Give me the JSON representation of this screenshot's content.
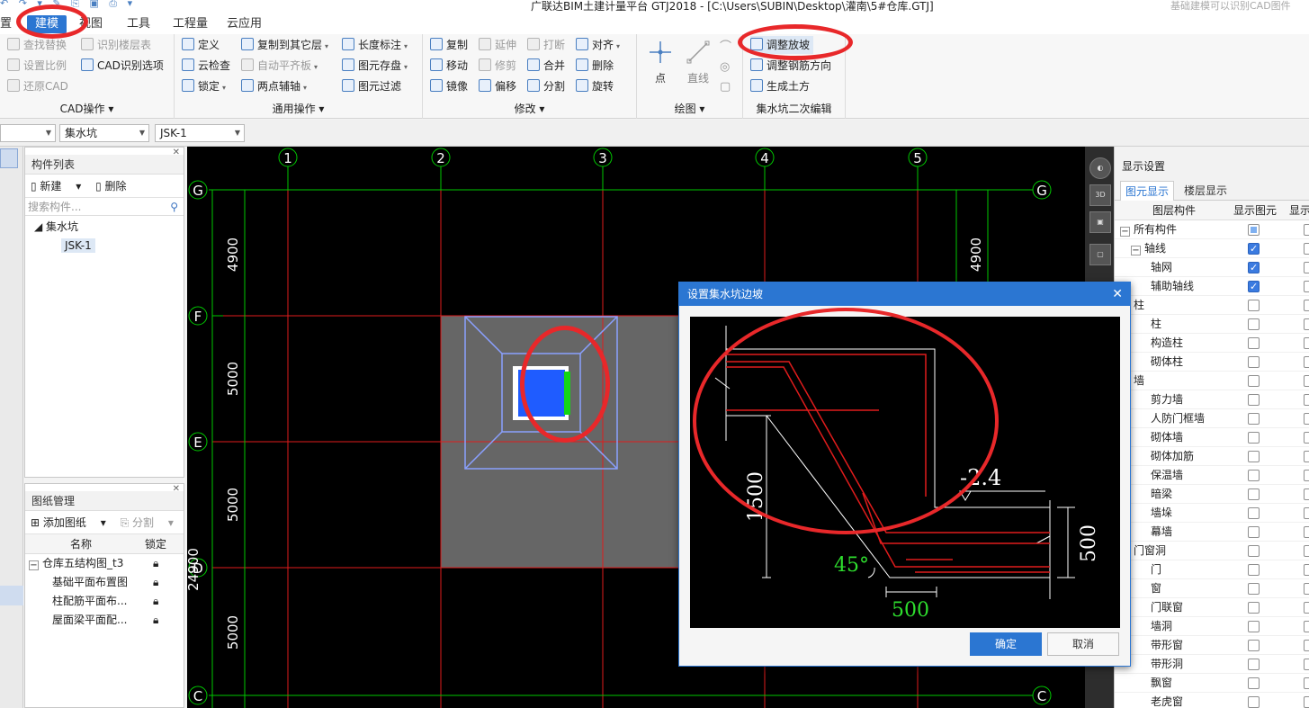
{
  "window": {
    "title": "广联达BIM土建计量平台 GTJ2018 - [C:\\Users\\SUBIN\\Desktop\\灌南\\5#仓库.GTJ]",
    "ghost_text": "基础建模可以识别CAD图件"
  },
  "menu": {
    "tabs": [
      "置",
      "建模",
      "视图",
      "工具",
      "工程量",
      "云应用"
    ],
    "active": "建模"
  },
  "ribbon": {
    "cad": {
      "label": "CAD操作",
      "items": [
        "查找替换",
        "识别楼层表",
        "设置比例",
        "CAD识别选项",
        "还原CAD"
      ]
    },
    "general": {
      "label": "通用操作",
      "items": [
        "定义",
        "复制到其它层",
        "长度标注",
        "云检查",
        "自动平齐板",
        "图元存盘",
        "锁定",
        "两点辅轴",
        "图元过滤"
      ]
    },
    "modify": {
      "label": "修改",
      "items": [
        "复制",
        "延伸",
        "打断",
        "对齐",
        "移动",
        "修剪",
        "合并",
        "删除",
        "镜像",
        "偏移",
        "分割",
        "旋转"
      ]
    },
    "draw": {
      "label": "绘图",
      "items": [
        "点",
        "直线"
      ]
    },
    "sump": {
      "label": "集水坑二次编辑",
      "items": [
        "调整放坡",
        "调整钢筋方向",
        "生成土方"
      ]
    }
  },
  "selectors": {
    "floor": "",
    "type": "集水坑",
    "component": "JSK-1"
  },
  "component_panel": {
    "title": "构件列表",
    "new_label": "新建",
    "delete_label": "删除",
    "search_placeholder": "搜索构件...",
    "category": "集水坑",
    "selected_item": "JSK-1"
  },
  "drawing_panel": {
    "title": "图纸管理",
    "add_label": "添加图纸",
    "split_label": "分割",
    "col_name": "名称",
    "col_lock": "锁定",
    "rows": [
      "仓库五结构图_t3",
      "基础平面布置图",
      "柱配筋平面布...",
      "屋面梁平面配..."
    ]
  },
  "canvas": {
    "axes_top": [
      "1",
      "2",
      "3",
      "4",
      "5"
    ],
    "axes_left": [
      "G",
      "F",
      "E",
      "D",
      "C"
    ],
    "dims_left": [
      "4900",
      "5000",
      "5000",
      "5000"
    ],
    "dim_right": "4900",
    "total_dim": "24900",
    "colors": {
      "axis": "#00c800",
      "grid": "#e01c1c",
      "slab": "#666666",
      "sump_outline": "#8aa0ff",
      "sump_fill": "#1f5cff"
    }
  },
  "dialog": {
    "title": "设置集水坑边坡",
    "close_label": "✕",
    "elevation": "-2.4",
    "depth": "1500",
    "angle": "45°",
    "width": "500",
    "thickness": "500",
    "ok_label": "确定",
    "cancel_label": "取消"
  },
  "display_panel": {
    "title": "显示设置",
    "tab_element": "图元显示",
    "tab_floor": "楼层显示",
    "col_layer": "图层构件",
    "col_show": "显示图元",
    "col_show2": "显示",
    "rows": [
      {
        "label": "所有构件",
        "level": 0,
        "state": "part",
        "exp": "−"
      },
      {
        "label": "轴线",
        "level": 1,
        "state": "on",
        "exp": "−"
      },
      {
        "label": "轴网",
        "level": 2,
        "state": "on"
      },
      {
        "label": "辅助轴线",
        "level": 2,
        "state": "on"
      },
      {
        "label": "柱",
        "level": 0,
        "state": "off",
        "exp": "−"
      },
      {
        "label": "柱",
        "level": 2,
        "state": "off"
      },
      {
        "label": "构造柱",
        "level": 2,
        "state": "off"
      },
      {
        "label": "砌体柱",
        "level": 2,
        "state": "off"
      },
      {
        "label": "墙",
        "level": 0,
        "state": "off",
        "exp": "−"
      },
      {
        "label": "剪力墙",
        "level": 2,
        "state": "off"
      },
      {
        "label": "人防门框墙",
        "level": 2,
        "state": "off"
      },
      {
        "label": "砌体墙",
        "level": 2,
        "state": "off"
      },
      {
        "label": "砌体加筋",
        "level": 2,
        "state": "off"
      },
      {
        "label": "保温墙",
        "level": 2,
        "state": "off"
      },
      {
        "label": "暗梁",
        "level": 2,
        "state": "off"
      },
      {
        "label": "墙垛",
        "level": 2,
        "state": "off"
      },
      {
        "label": "幕墙",
        "level": 2,
        "state": "off"
      },
      {
        "label": "门窗洞",
        "level": 0,
        "state": "off",
        "exp": "−"
      },
      {
        "label": "门",
        "level": 2,
        "state": "off"
      },
      {
        "label": "窗",
        "level": 2,
        "state": "off"
      },
      {
        "label": "门联窗",
        "level": 2,
        "state": "off"
      },
      {
        "label": "墙洞",
        "level": 2,
        "state": "off"
      },
      {
        "label": "带形窗",
        "level": 2,
        "state": "off"
      },
      {
        "label": "带形洞",
        "level": 2,
        "state": "off"
      },
      {
        "label": "飘窗",
        "level": 2,
        "state": "off"
      },
      {
        "label": "老虎窗",
        "level": 2,
        "state": "off"
      }
    ]
  }
}
